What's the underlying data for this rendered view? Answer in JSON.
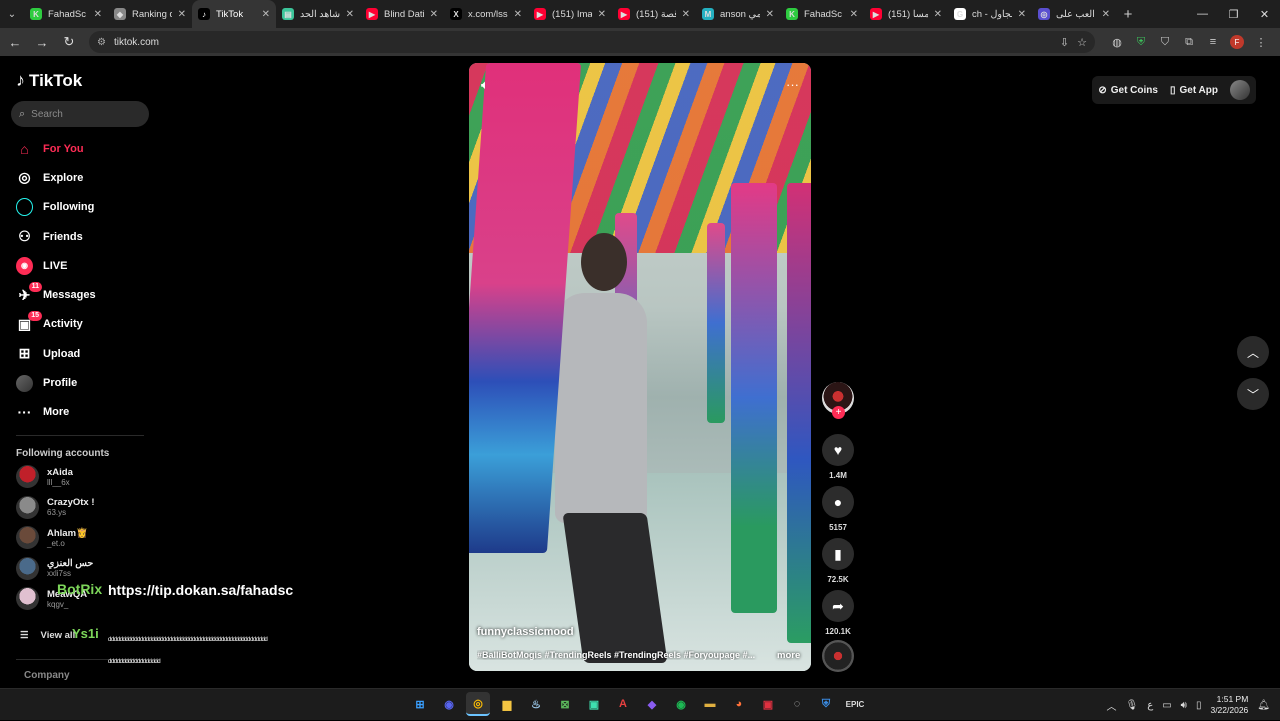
{
  "browser": {
    "tabs": [
      {
        "title": "FahadSc S",
        "favicon_color": "#2ecc40",
        "favicon": "K"
      },
      {
        "title": "Ranking d",
        "favicon_color": "#888888",
        "favicon": "◆"
      },
      {
        "title": "TikTok",
        "favicon_color": "#000000",
        "favicon": "♪",
        "active": true
      },
      {
        "title": "شاهد الحد",
        "favicon_color": "#3cc59a",
        "favicon": "▤"
      },
      {
        "title": "Blind Datin",
        "favicon_color": "#ff0033",
        "favicon": "▶"
      },
      {
        "title": "x.com/lsso",
        "favicon_color": "#000000",
        "favicon": "X"
      },
      {
        "title": "(151) Imag",
        "favicon_color": "#ff0033",
        "favicon": "▶"
      },
      {
        "title": "(151) قصة",
        "favicon_color": "#ff0033",
        "favicon": "▶"
      },
      {
        "title": "anson انمي",
        "favicon_color": "#24b0c0",
        "favicon": "M"
      },
      {
        "title": "FahadSc S",
        "favicon_color": "#2ecc40",
        "favicon": "K"
      },
      {
        "title": "(151) مسا",
        "favicon_color": "#ff0033",
        "favicon": "▶"
      },
      {
        "title": "ch - مجاول",
        "favicon_color": "#ffffff",
        "favicon": "G"
      },
      {
        "title": "العب على",
        "favicon_color": "#5a4fd0",
        "favicon": "◎"
      }
    ],
    "url": "tiktok.com"
  },
  "tiktok": {
    "logo": "TikTok",
    "search_placeholder": "Search",
    "nav": [
      {
        "label": "For You",
        "icon": "home-icon",
        "active": true
      },
      {
        "label": "Explore",
        "icon": "compass-icon"
      },
      {
        "label": "Following",
        "icon": "following-icon"
      },
      {
        "label": "Friends",
        "icon": "friends-icon"
      },
      {
        "label": "LIVE",
        "icon": "live-icon"
      },
      {
        "label": "Messages",
        "icon": "messages-icon",
        "badge": "11"
      },
      {
        "label": "Activity",
        "icon": "activity-icon",
        "badge": "15"
      },
      {
        "label": "Upload",
        "icon": "upload-icon"
      },
      {
        "label": "Profile",
        "icon": "profile-icon"
      },
      {
        "label": "More",
        "icon": "more-icon"
      }
    ],
    "following_heading": "Following accounts",
    "following": [
      {
        "name": "xAida",
        "handle": "lll__6x",
        "color": "#c0202a"
      },
      {
        "name": "CrazyOtx !",
        "handle": "63.ys",
        "color": "#8a8a8a"
      },
      {
        "name": "Ahlam👸",
        "handle": "_et.o",
        "color": "#6a4a3a"
      },
      {
        "name": "حس العنزي",
        "handle": "xxli7ss",
        "color": "#4a6a8a"
      },
      {
        "name": "MeawQA",
        "handle": "kqgv_",
        "color": "#e0c0d0"
      }
    ],
    "view_all": "View all",
    "company": "Company",
    "top_right": {
      "coins": "Get Coins",
      "app": "Get App"
    },
    "video": {
      "author": "funnyclassicmood",
      "caption": "#BalliBotMogis #TrendingReels #TrendingReels #Foryoupage #...",
      "more": "more"
    },
    "actions": {
      "likes": "1.4M",
      "comments": "5157",
      "saves": "72.5K",
      "shares": "120.1K"
    }
  },
  "overlay": {
    "bot": "BotRix",
    "ys": "Ys1i",
    "url": "https://tip.dokan.sa/fahadsc",
    "garble": "ᵈᵈᵈᵈᵈᵈᵈᵈᵈᵈᵈᵈᵈᵈᵈᵈᵈᵈᵈᵈᵈᵈᵈᵈᵈᵈᵈᵈᵈᵈᵈᵈᵈᵈᵈᵈᵈᵈᵈᵈᵈᵈᵈᵈᵈᵈᵈᵈᵈᵈᵈᵈᵈᵈᵈᵈᵈᵈᵈᵈᵈᵈᵈᵈᵈᵈᵈᵈᵈᵈᵈᵈᵈ"
  },
  "taskbar": {
    "time": "1:51 PM",
    "date": "3/22/2026",
    "lang": "ع"
  }
}
